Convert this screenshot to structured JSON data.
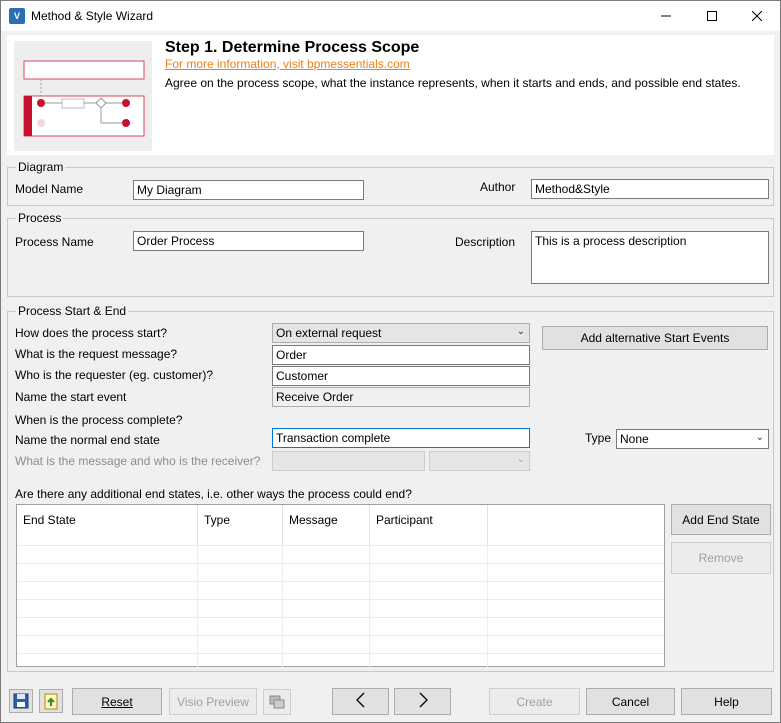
{
  "window": {
    "title": "Method & Style Wizard",
    "icon": "app-icon",
    "controls": [
      "minimize-icon",
      "maximize-icon",
      "close-icon"
    ]
  },
  "header": {
    "step_title": "Step 1. Determine Process Scope",
    "link_text": "For more information, visit bpmessentials.com",
    "description": "Agree on the process scope, what the instance represents, when it starts and ends, and possible end states.",
    "link_color": "#e8821a"
  },
  "diagram": {
    "group_label": "Diagram",
    "model_name_label": "Model Name",
    "model_name_value": "My Diagram",
    "author_label": "Author",
    "author_value": "Method&Style"
  },
  "process": {
    "group_label": "Process",
    "process_name_label": "Process Name",
    "process_name_value": "Order Process",
    "description_label": "Description",
    "description_value": "This is a process description"
  },
  "start_end": {
    "group_label": "Process Start & End",
    "how_start_label": "How does the process start?",
    "how_start_value": "On external request",
    "add_alt_start_button": "Add alternative Start Events",
    "request_message_label": "What is the request message?",
    "request_message_value": "Order",
    "requester_label": "Who is the requester (eg. customer)?",
    "requester_value": "Customer",
    "start_event_label": "Name the start event",
    "start_event_value": "Receive Order",
    "complete_label": "When is the process complete?",
    "normal_end_label": "Name the normal end state",
    "normal_end_value": "Transaction complete",
    "type_label": "Type",
    "type_value": "None",
    "message_receiver_label": "What is the message and who is the receiver?",
    "additional_end_label": "Are there any additional end states, i.e. other ways the process could end?"
  },
  "end_states_grid": {
    "columns": [
      "End State",
      "Type",
      "Message",
      "Participant",
      ""
    ],
    "rows": []
  },
  "side_buttons": {
    "add_end_state": "Add End State",
    "remove": "Remove"
  },
  "footer": {
    "reset": "Reset",
    "visio_preview": "Visio Preview",
    "back_icon": "chevron-left-icon",
    "next_icon": "chevron-right-icon",
    "create": "Create",
    "cancel": "Cancel",
    "help": "Help",
    "save_icon": "save-icon",
    "open_icon": "open-icon",
    "copy_icon": "copy-icon"
  },
  "colors": {
    "accent_red": "#c8102e",
    "focus_blue": "#0078d7"
  }
}
